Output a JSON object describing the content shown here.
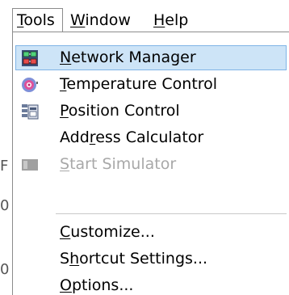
{
  "menubar": {
    "tools": {
      "pre": "",
      "key": "T",
      "post": "ools"
    },
    "window": {
      "pre": "",
      "key": "W",
      "post": "indow"
    },
    "help": {
      "pre": "",
      "key": "H",
      "post": "elp"
    }
  },
  "menu": {
    "items": [
      {
        "pre": "",
        "key": "N",
        "post": "etwork Manager",
        "icon": "network-manager-icon",
        "state": "highlighted"
      },
      {
        "pre": "",
        "key": "T",
        "post": "emperature Control",
        "icon": "temperature-control-icon",
        "state": "enabled"
      },
      {
        "pre": "",
        "key": "P",
        "post": "osition Control",
        "icon": "position-control-icon",
        "state": "enabled"
      },
      {
        "pre": "Add",
        "key": "r",
        "post": "ess Calculator",
        "icon": "",
        "state": "enabled"
      },
      {
        "pre": "",
        "key": "S",
        "post": "tart Simulator",
        "icon": "start-simulator-icon",
        "state": "disabled"
      },
      {
        "pre": "",
        "key": "C",
        "post": "ustomize...",
        "icon": "",
        "state": "enabled"
      },
      {
        "pre": "S",
        "key": "h",
        "post": "ortcut Settings...",
        "icon": "",
        "state": "enabled"
      },
      {
        "pre": "",
        "key": "O",
        "post": "ptions...",
        "icon": "",
        "state": "enabled"
      }
    ]
  },
  "background_fragments": [
    "F",
    "0",
    "0"
  ],
  "colors": {
    "highlight_fill": "#cde4f7",
    "highlight_border": "#7fb4e6",
    "disabled_text": "#a8a8a8"
  }
}
